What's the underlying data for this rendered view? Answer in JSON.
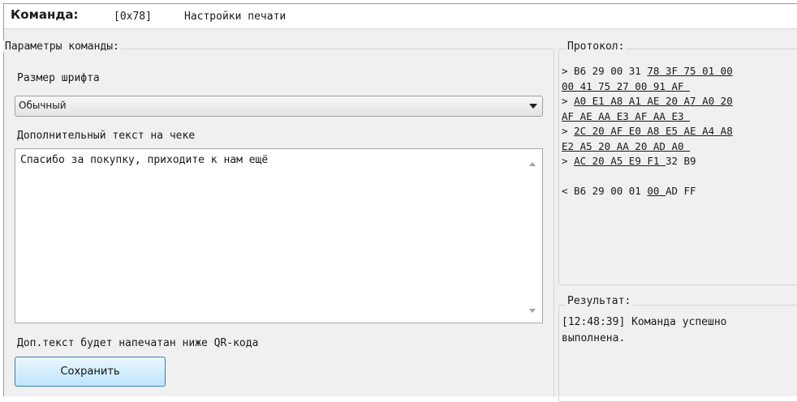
{
  "header": {
    "command_label": "Команда:",
    "command_code": "[0x78]",
    "command_title": "Настройки печати"
  },
  "params": {
    "title": "Параметры команды:",
    "font_size_label": "Размер шрифта",
    "font_size_value": "Обычный",
    "extra_text_label": "Дополнительный текст на чеке",
    "extra_text_value": "Спасибо за покупку, приходите к нам ещё",
    "note": "Доп.текст будет напечатан ниже QR-кода",
    "save_label": "Сохранить"
  },
  "protocol": {
    "title": "Протокол:",
    "lines": [
      [
        {
          "t": "> B6 29 00 31 "
        },
        {
          "t": "78 3F 75 01 00",
          "u": true
        }
      ],
      [
        {
          "t": "00 41 75 27 00 91 AF ",
          "u": true
        }
      ],
      [
        {
          "t": "> "
        },
        {
          "t": "A0 E1 A8 A1 AE 20 A7 A0 20",
          "u": true
        }
      ],
      [
        {
          "t": "AF AE AA E3 AF AA E3 ",
          "u": true
        }
      ],
      [
        {
          "t": "> "
        },
        {
          "t": "2C 20 AF E0 A8 E5 AE A4 A8",
          "u": true
        }
      ],
      [
        {
          "t": "E2 A5 20 AA 20 AD A0 ",
          "u": true
        }
      ],
      [
        {
          "t": "> "
        },
        {
          "t": "AC 20 A5 E9 F1 ",
          "u": true
        },
        {
          "t": "32 B9"
        }
      ],
      [
        {
          "t": ""
        }
      ],
      [
        {
          "t": "< B6 29 00 01 "
        },
        {
          "t": "00 ",
          "u": true
        },
        {
          "t": "AD FF"
        }
      ]
    ]
  },
  "result": {
    "title": "Результат:",
    "text": "[12:48:39] Команда успешно выполнена."
  }
}
